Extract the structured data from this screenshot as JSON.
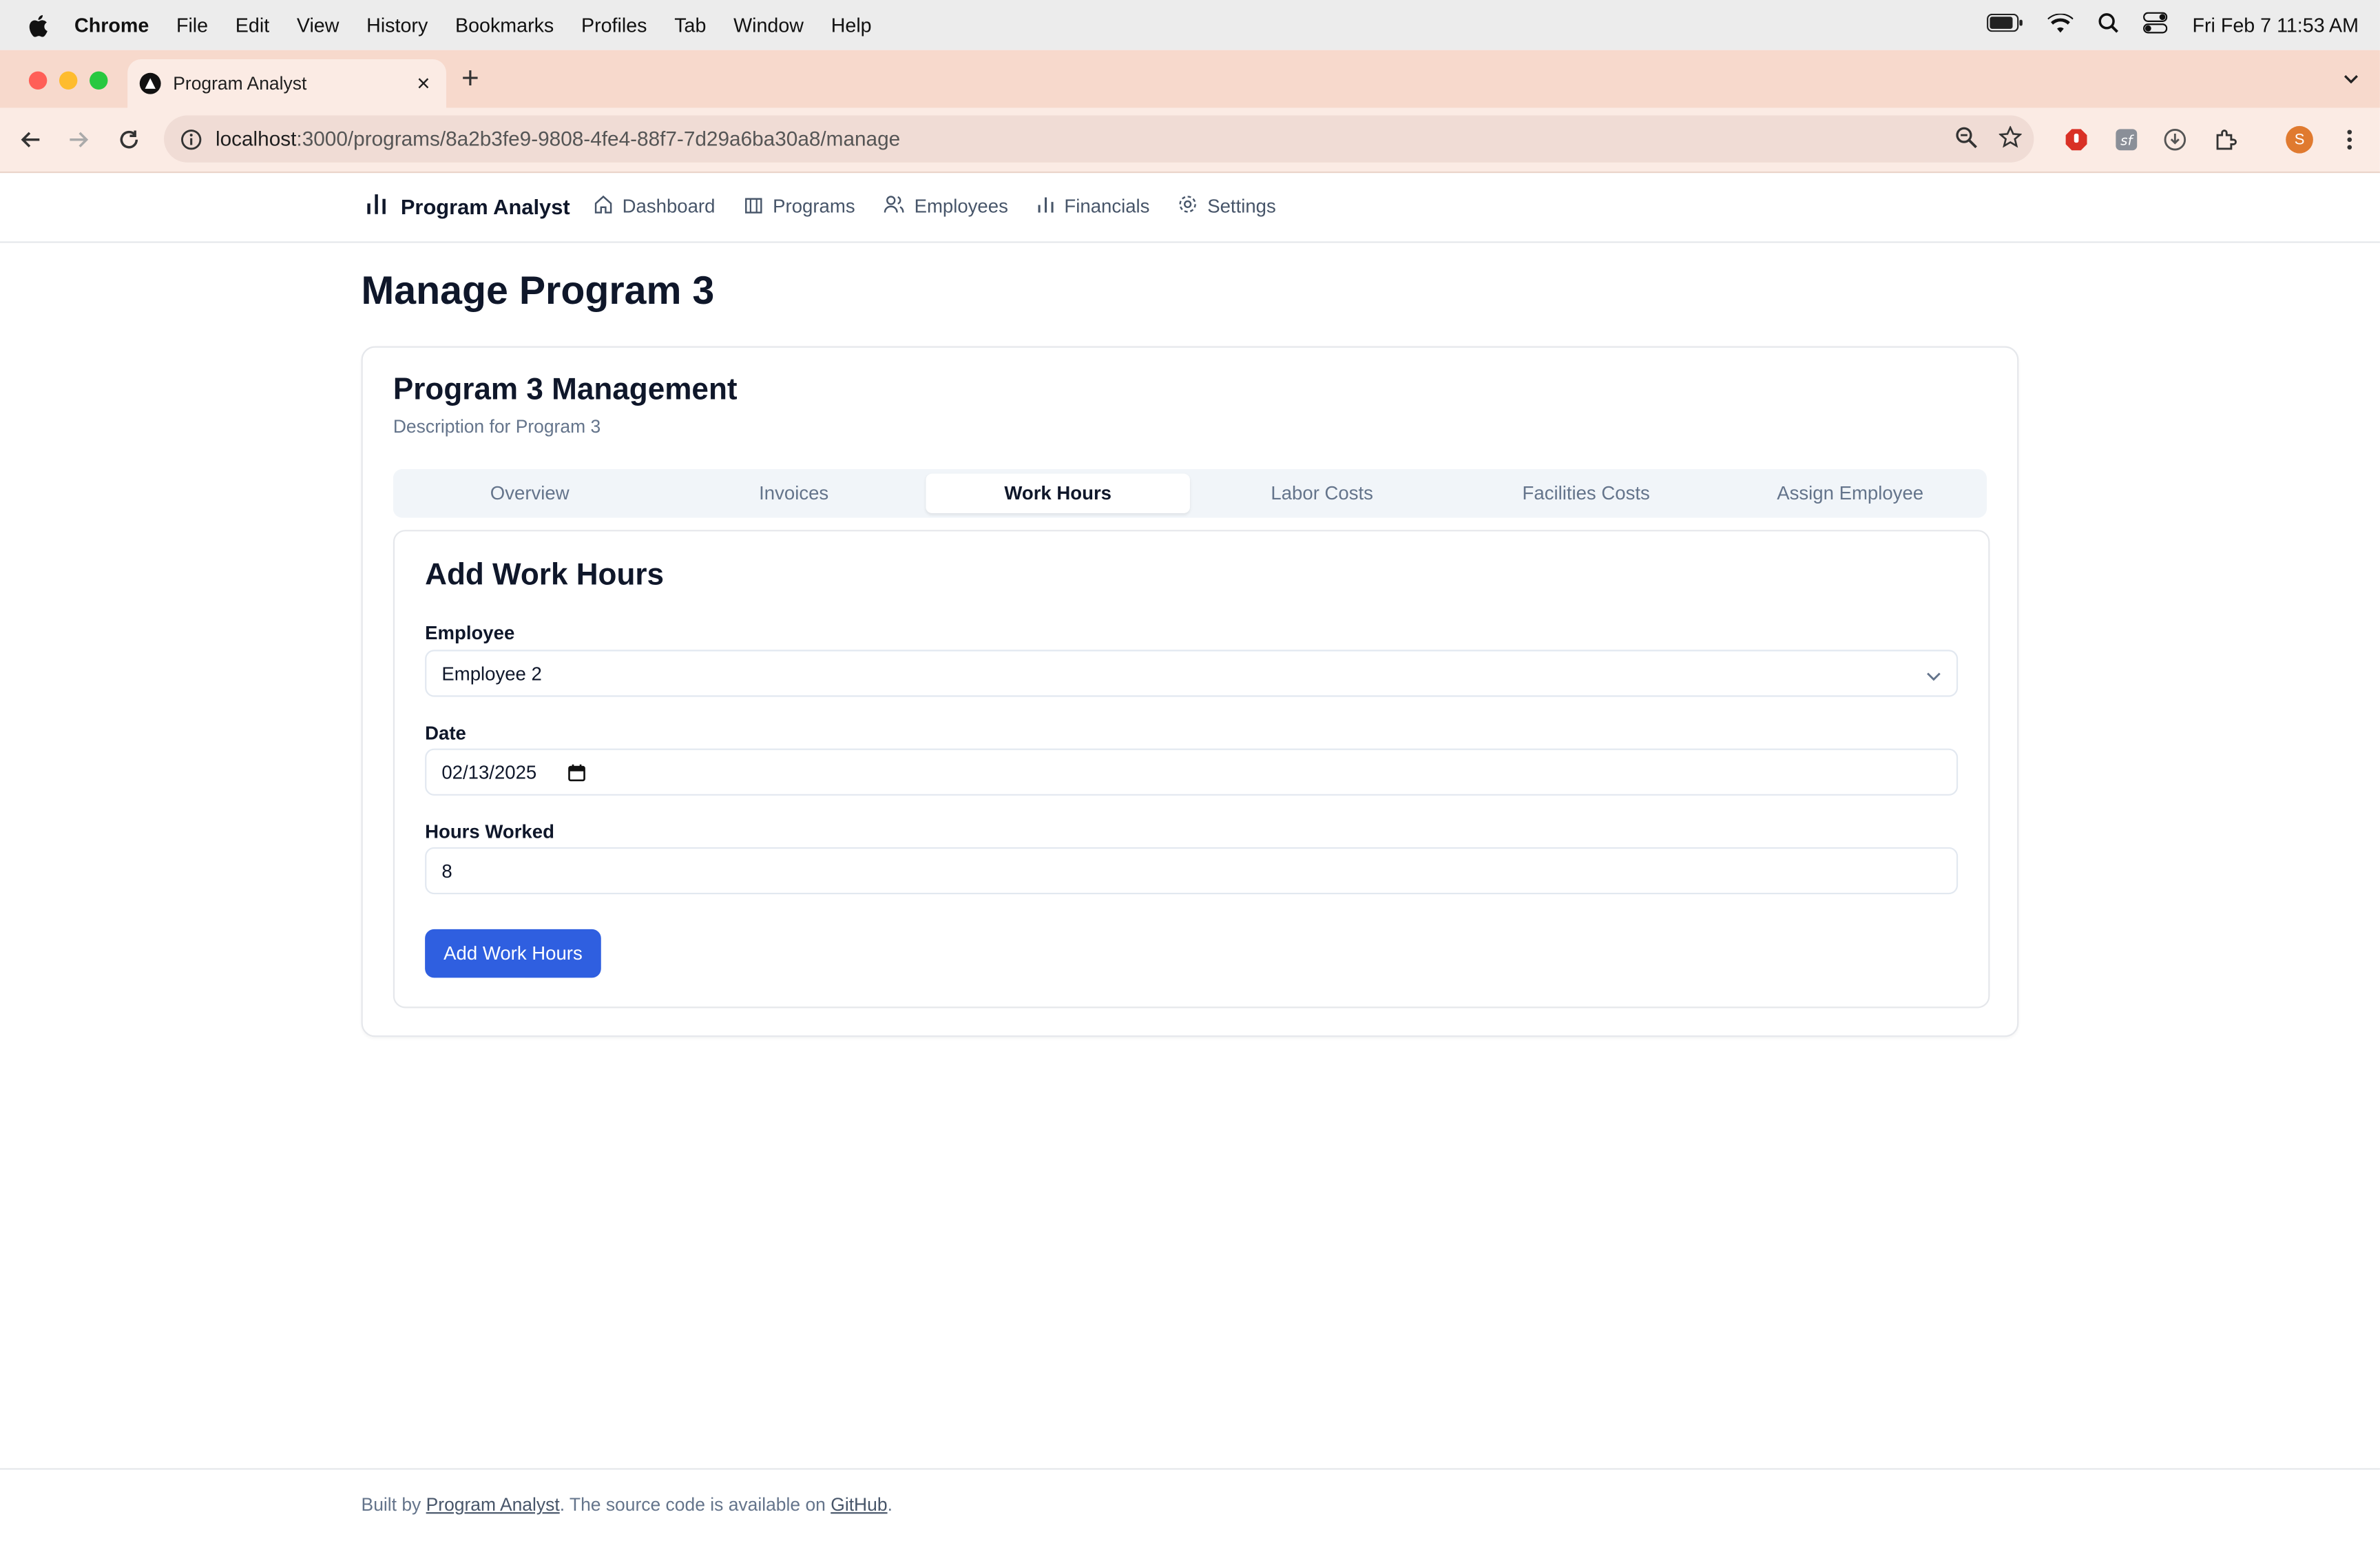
{
  "menubar": {
    "items": [
      "Chrome",
      "File",
      "Edit",
      "View",
      "History",
      "Bookmarks",
      "Profiles",
      "Tab",
      "Window",
      "Help"
    ],
    "clock": "Fri Feb 7  11:53 AM"
  },
  "browser": {
    "tab_title": "Program Analyst",
    "url_host": "localhost",
    "url_path": ":3000/programs/8a2b3fe9-9808-4fe4-88f7-7d29a6ba30a8/manage",
    "profile_initial": "S"
  },
  "app": {
    "brand": "Program Analyst",
    "nav": [
      {
        "label": "Dashboard",
        "icon": "home-icon"
      },
      {
        "label": "Programs",
        "icon": "building-icon"
      },
      {
        "label": "Employees",
        "icon": "users-icon"
      },
      {
        "label": "Financials",
        "icon": "bar-chart-icon"
      },
      {
        "label": "Settings",
        "icon": "gear-icon"
      }
    ]
  },
  "main": {
    "page_title": "Manage Program 3",
    "card_title": "Program 3 Management",
    "card_description": "Description for Program 3",
    "tabs": [
      "Overview",
      "Invoices",
      "Work Hours",
      "Labor Costs",
      "Facilities Costs",
      "Assign Employee"
    ],
    "active_tab": "Work Hours",
    "form": {
      "title": "Add Work Hours",
      "employee_label": "Employee",
      "employee_value": "Employee 2",
      "date_label": "Date",
      "date_value": "02/13/2025",
      "hours_label": "Hours Worked",
      "hours_value": "8",
      "submit_label": "Add Work Hours"
    }
  },
  "footer": {
    "prefix": "Built by ",
    "link1": "Program Analyst",
    "middle": ". The source code is available on ",
    "link2": "GitHub",
    "suffix": "."
  },
  "colors": {
    "accent": "#2f5fe0",
    "tabstrip": "#f7d9cc",
    "toolbar": "#fbebe4"
  }
}
